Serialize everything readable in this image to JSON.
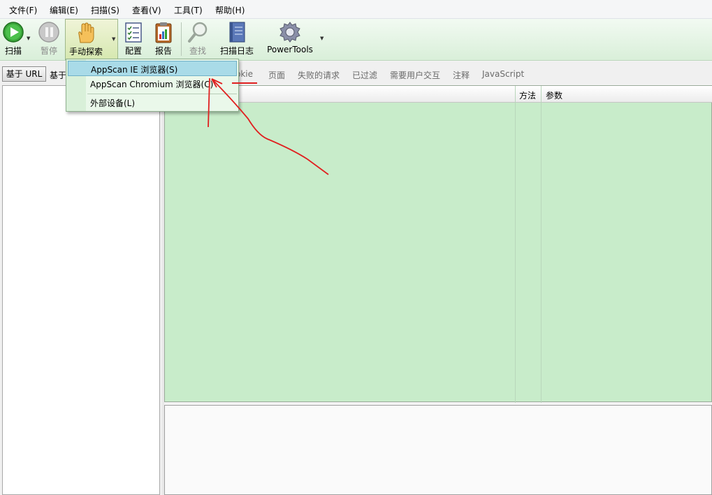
{
  "menubar": {
    "items": [
      "文件(F)",
      "编辑(E)",
      "扫描(S)",
      "查看(V)",
      "工具(T)",
      "帮助(H)"
    ]
  },
  "toolbar": {
    "scan": "扫描",
    "pause": "暂停",
    "manual_explore": "手动探索",
    "config": "配置",
    "report": "报告",
    "find": "查找",
    "scan_log": "扫描日志",
    "powertools": "PowerTools"
  },
  "left": {
    "url_button": "基于 URL",
    "other_tab": "基于"
  },
  "right_tabs": [
    "okie",
    "页面",
    "失败的请求",
    "已过滤",
    "需要用户交互",
    "注释",
    "JavaScript"
  ],
  "grid": {
    "columns": [
      "方法",
      "参数"
    ]
  },
  "dropdown": {
    "items": [
      "AppScan IE 浏览器(S)",
      "AppScan Chromium 浏览器(C)",
      "外部设备(L)"
    ]
  },
  "colors": {
    "grid_bg": "#c8ecca",
    "annotation": "#e02020",
    "highlight": "#a9dbe8"
  }
}
